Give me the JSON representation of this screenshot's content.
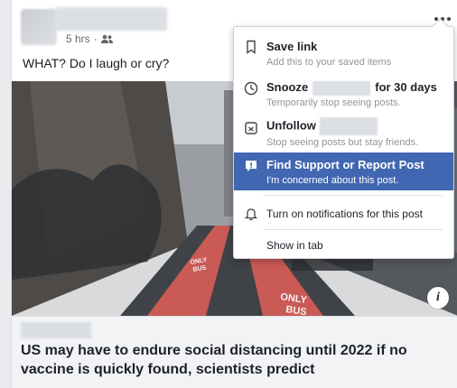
{
  "post": {
    "time": "5 hrs",
    "dot": "·",
    "text": "WHAT? Do I laugh or cry?",
    "photo_labels": {
      "lane1": "ONLY",
      "lane2": "BUS",
      "lane3": "ONLY",
      "lane4": "BUS"
    },
    "info": "i",
    "headline": "US may have to endure social distancing until 2022 if no vaccine is quickly found, scientists predict"
  },
  "menu": {
    "save": {
      "title": "Save link",
      "sub": "Add this to your saved items"
    },
    "snooze": {
      "title_a": "Snooze",
      "title_b": "for 30 days",
      "sub": "Temporarily stop seeing posts."
    },
    "unfollow": {
      "title": "Unfollow",
      "sub": "Stop seeing posts but stay friends."
    },
    "report": {
      "title": "Find Support or Report Post",
      "sub": "I'm concerned about this post."
    },
    "notifications": "Turn on notifications for this post",
    "show_tab": "Show in tab"
  },
  "colors": {
    "accent": "#4267b2",
    "menu_sub": "#90949c"
  }
}
